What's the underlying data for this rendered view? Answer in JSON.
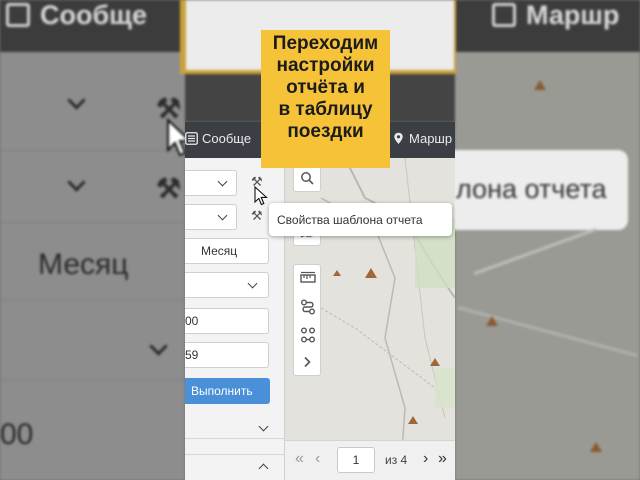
{
  "background": {
    "tab_messages": "Сообще",
    "tab_routes": "Маршр",
    "period_value": "Месяц",
    "value_partial": "00",
    "tooltip_partial": "лона отчета"
  },
  "caption": {
    "lines": [
      "Переходим",
      "настройки",
      "отчёта и",
      "в таблицу",
      "поездки"
    ]
  },
  "tabs": {
    "messages": "Сообще",
    "routes": "Маршр"
  },
  "panel": {
    "period": "Месяц",
    "time_from_partial": "00",
    "time_to_partial": "59",
    "run_button": "Выполнить"
  },
  "tooltip": {
    "text": "Свойства шаблона отчета"
  },
  "pager": {
    "page": "1",
    "of_label": "из 4"
  },
  "colors": {
    "caption_bg": "#f6c238",
    "run_button": "#4a90d9",
    "tabbar": "#3b3f45"
  }
}
